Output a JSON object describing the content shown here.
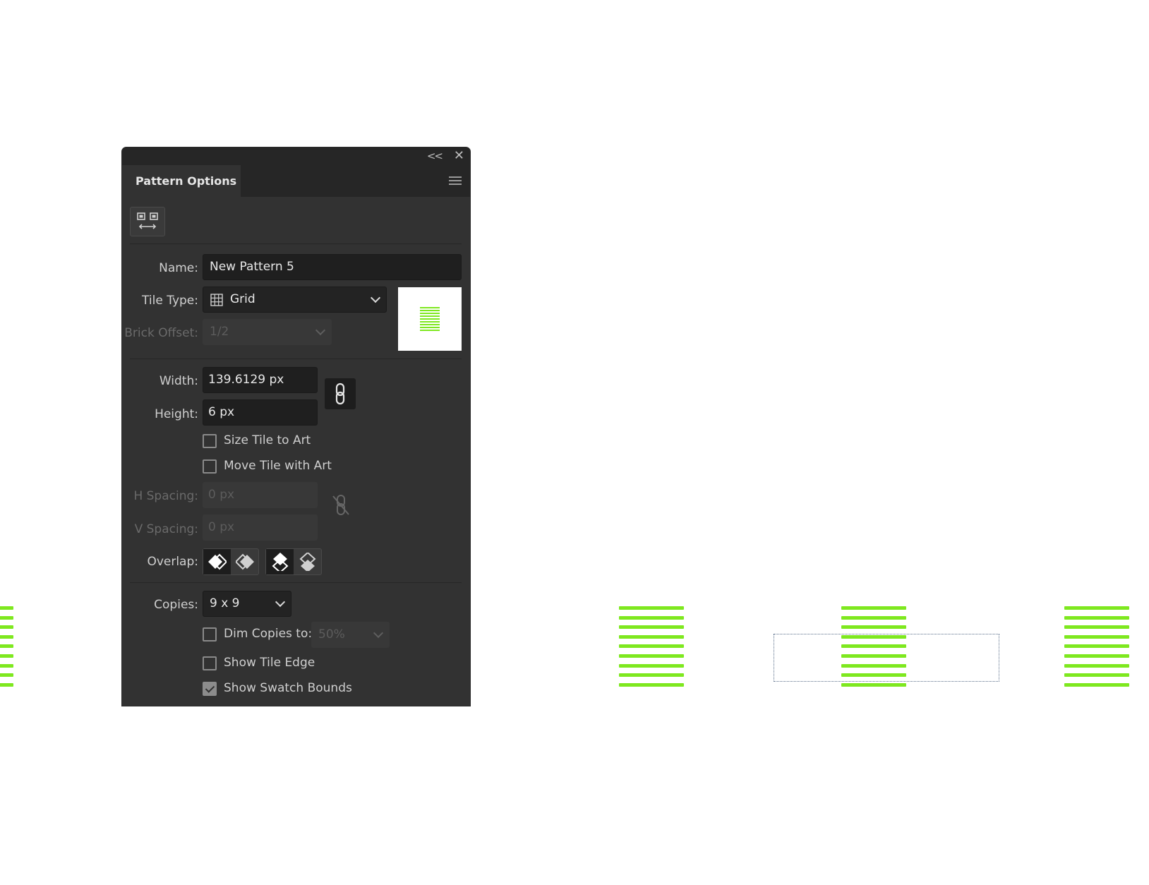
{
  "panel": {
    "title": "Pattern Options",
    "collapse_icon": "double-chevron-left-icon",
    "close_icon": "close-icon",
    "menu_icon": "hamburger-menu-icon",
    "tool_icon": "tile-editing-tool-icon"
  },
  "name": {
    "label": "Name:",
    "value": "New Pattern 5"
  },
  "tile_type": {
    "label": "Tile Type:",
    "value": "Grid",
    "icon": "grid-icon"
  },
  "brick_offset": {
    "label": "Brick Offset:",
    "value": "1/2"
  },
  "width": {
    "label": "Width:",
    "value": "139.6129 px"
  },
  "height": {
    "label": "Height:",
    "value": "6 px"
  },
  "link_icon": "link-chain-icon",
  "unlink_icon": "unlink-chain-icon",
  "size_tile_to_art": {
    "label": "Size Tile to Art",
    "checked": false
  },
  "move_tile_with_art": {
    "label": "Move Tile with Art",
    "checked": false
  },
  "h_spacing": {
    "label": "H Spacing:",
    "value": "0 px"
  },
  "v_spacing": {
    "label": "V Spacing:",
    "value": "0 px"
  },
  "overlap": {
    "label": "Overlap:",
    "buttons": [
      "left-in-front-icon",
      "right-in-front-icon",
      "top-in-front-icon",
      "bottom-in-front-icon"
    ]
  },
  "copies": {
    "label": "Copies:",
    "value": "9 x 9"
  },
  "dim_copies": {
    "label": "Dim Copies to:",
    "value": "50%",
    "checked": false
  },
  "show_tile_edge": {
    "label": "Show Tile Edge",
    "checked": false
  },
  "show_swatch_bounds": {
    "label": "Show Swatch Bounds",
    "checked": true
  },
  "colors": {
    "stripe": "#7ee81f",
    "panel_bg": "#323232",
    "header_bg": "#262626"
  }
}
